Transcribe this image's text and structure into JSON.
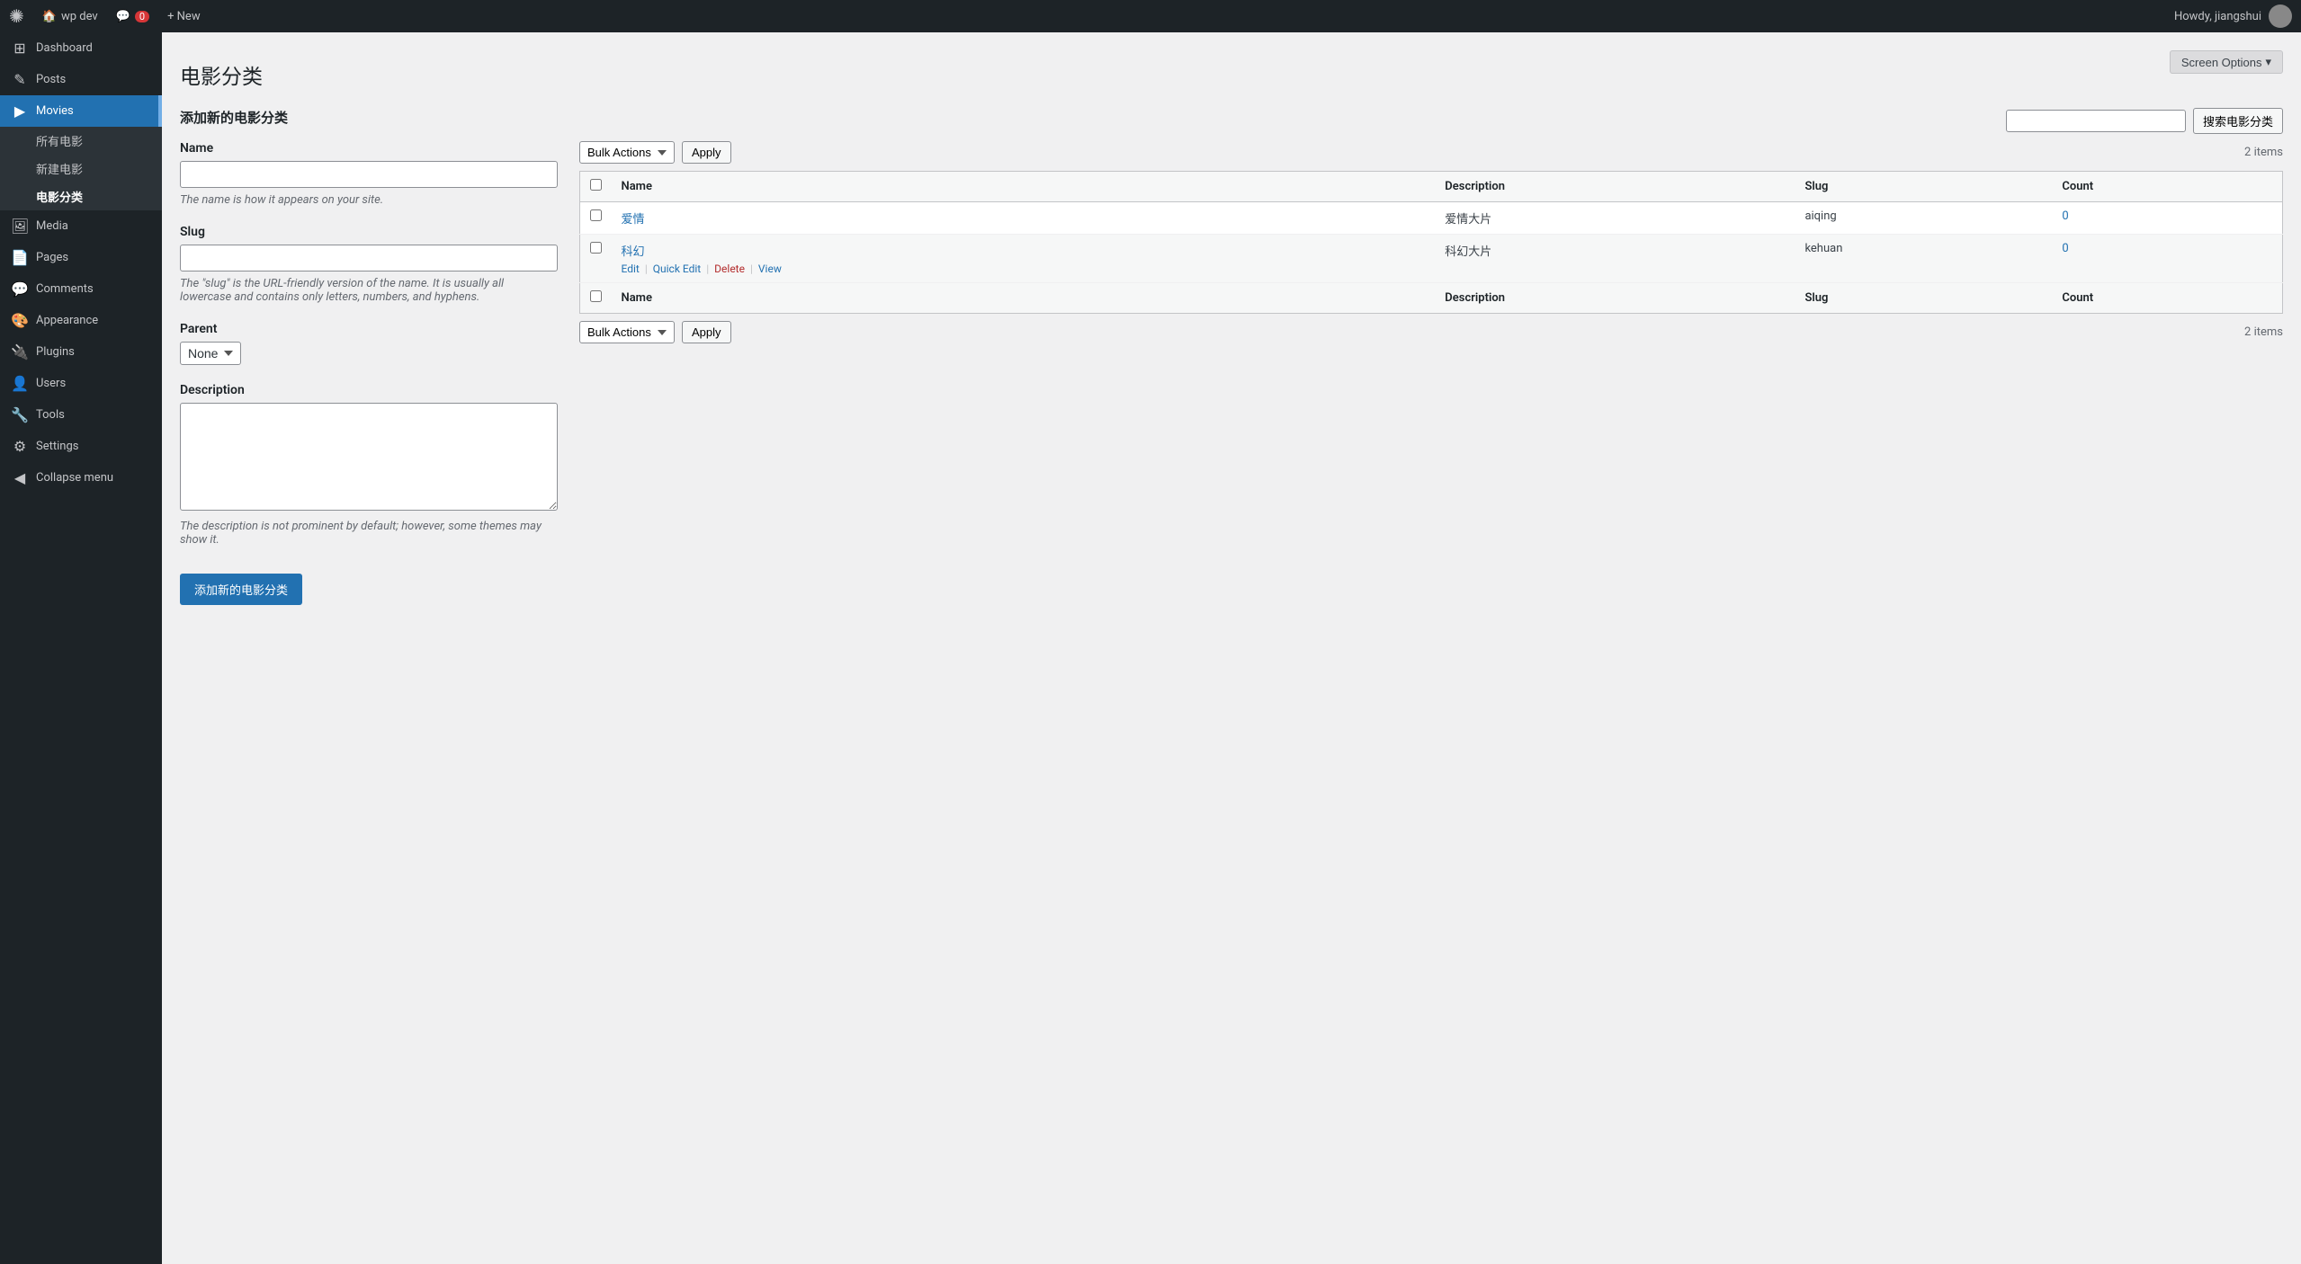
{
  "adminbar": {
    "logo": "✺",
    "site_name": "wp dev",
    "comments_count": "0",
    "new_label": "+ New",
    "howdy": "Howdy, jiangshui"
  },
  "screen_options": {
    "label": "Screen Options",
    "arrow": "▾"
  },
  "page": {
    "title": "电影分类"
  },
  "form": {
    "section_title": "添加新的电影分类",
    "name_label": "Name",
    "name_placeholder": "",
    "name_hint": "The name is how it appears on your site.",
    "slug_label": "Slug",
    "slug_placeholder": "",
    "slug_hint": "The \"slug\" is the URL-friendly version of the name. It is usually all lowercase and contains only letters, numbers, and hyphens.",
    "parent_label": "Parent",
    "parent_option": "None",
    "description_label": "Description",
    "description_hint": "The description is not prominent by default; however, some themes may show it.",
    "submit_label": "添加新的电影分类"
  },
  "search": {
    "placeholder": "",
    "button_label": "搜索电影分类"
  },
  "bulk_top": {
    "select_label": "Bulk Actions",
    "apply_label": "Apply",
    "items_count": "2 items"
  },
  "bulk_bottom": {
    "select_label": "Bulk Actions",
    "apply_label": "Apply",
    "items_count": "2 items"
  },
  "table": {
    "columns": [
      {
        "id": "name",
        "label": "Name"
      },
      {
        "id": "description",
        "label": "Description"
      },
      {
        "id": "slug",
        "label": "Slug"
      },
      {
        "id": "count",
        "label": "Count"
      }
    ],
    "rows": [
      {
        "id": 1,
        "name": "爱情",
        "description": "爱情大片",
        "slug": "aiqing",
        "count": "0",
        "actions": [
          {
            "label": "Edit",
            "type": "edit"
          },
          {
            "label": "Quick Edit",
            "type": "quick-edit"
          },
          {
            "label": "Delete",
            "type": "delete"
          },
          {
            "label": "View",
            "type": "view"
          }
        ],
        "show_actions": false
      },
      {
        "id": 2,
        "name": "科幻",
        "description": "科幻大片",
        "slug": "kehuan",
        "count": "0",
        "actions": [
          {
            "label": "Edit",
            "type": "edit"
          },
          {
            "label": "Quick Edit",
            "type": "quick-edit"
          },
          {
            "label": "Delete",
            "type": "delete"
          },
          {
            "label": "View",
            "type": "view"
          }
        ],
        "show_actions": true
      }
    ]
  },
  "sidebar": {
    "items": [
      {
        "id": "dashboard",
        "label": "Dashboard",
        "icon": "⊞",
        "active": false
      },
      {
        "id": "posts",
        "label": "Posts",
        "icon": "✎",
        "active": false
      },
      {
        "id": "movies",
        "label": "Movies",
        "icon": "▶",
        "active": true
      },
      {
        "id": "media",
        "label": "Media",
        "icon": "🖼",
        "active": false
      },
      {
        "id": "pages",
        "label": "Pages",
        "icon": "📄",
        "active": false
      },
      {
        "id": "comments",
        "label": "Comments",
        "icon": "💬",
        "active": false
      },
      {
        "id": "appearance",
        "label": "Appearance",
        "icon": "🎨",
        "active": false
      },
      {
        "id": "plugins",
        "label": "Plugins",
        "icon": "🔌",
        "active": false
      },
      {
        "id": "users",
        "label": "Users",
        "icon": "👤",
        "active": false
      },
      {
        "id": "tools",
        "label": "Tools",
        "icon": "🔧",
        "active": false
      },
      {
        "id": "settings",
        "label": "Settings",
        "icon": "⚙",
        "active": false
      },
      {
        "id": "collapse",
        "label": "Collapse menu",
        "icon": "◀",
        "active": false
      }
    ],
    "movies_submenu": [
      {
        "id": "all-movies",
        "label": "所有电影"
      },
      {
        "id": "new-movie",
        "label": "新建电影"
      },
      {
        "id": "movie-category",
        "label": "电影分类",
        "current": true
      }
    ]
  }
}
